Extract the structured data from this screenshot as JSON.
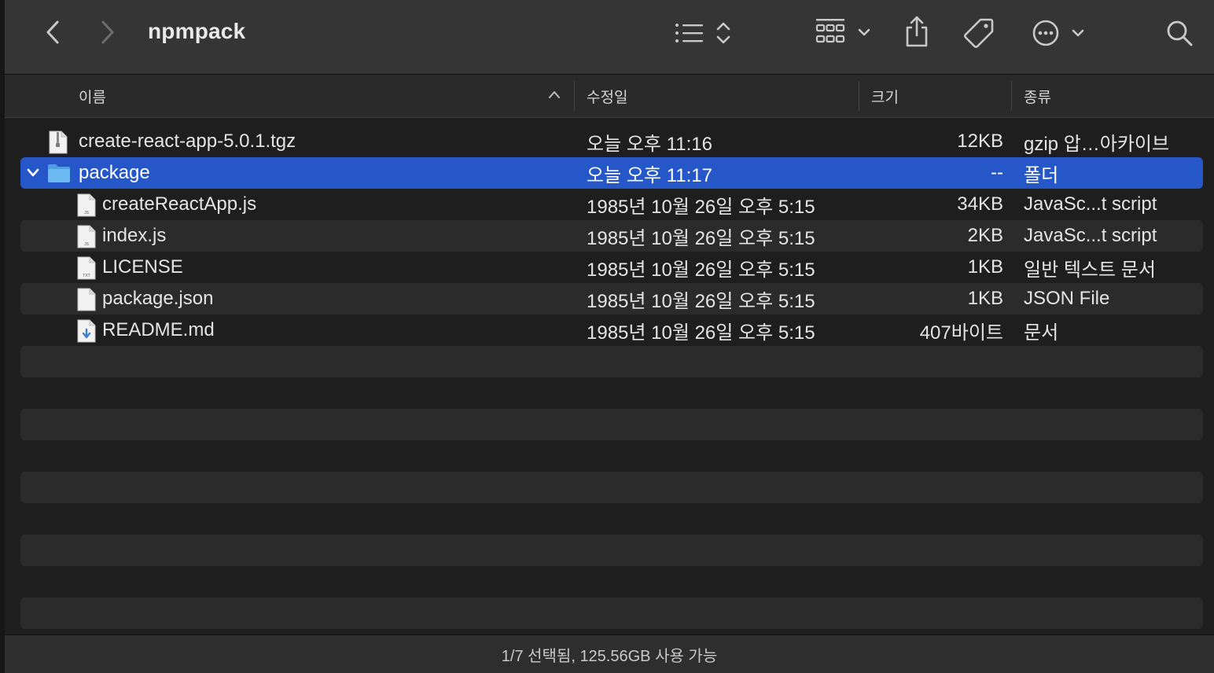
{
  "toolbar": {
    "title": "npmpack",
    "icons": [
      "back-icon",
      "forward-icon",
      "list-view-icon",
      "sort-updown-icon",
      "gallery-grid-icon",
      "chevron-down-icon",
      "share-icon",
      "tag-icon",
      "more-circle-icon",
      "chevron-down-icon",
      "search-icon"
    ]
  },
  "columns": {
    "name": "이름",
    "modified": "수정일",
    "size": "크기",
    "kind": "종류"
  },
  "files": [
    {
      "name": "create-react-app-5.0.1.tgz",
      "modified": "오늘 오후 11:16",
      "size": "12KB",
      "kind": "gzip 압…아카이브",
      "icon": "archive-file-icon"
    },
    {
      "name": "package",
      "modified": "오늘 오후 11:17",
      "size": "--",
      "kind": "폴더",
      "icon": "folder-icon",
      "selected": true,
      "expanded": true
    },
    {
      "name": "createReactApp.js",
      "modified": "1985년 10월 26일 오후 5:15",
      "size": "34KB",
      "kind": "JavaSc...t script",
      "icon": "js-file-icon"
    },
    {
      "name": "index.js",
      "modified": "1985년 10월 26일 오후 5:15",
      "size": "2KB",
      "kind": "JavaSc...t script",
      "icon": "js-file-icon"
    },
    {
      "name": "LICENSE",
      "modified": "1985년 10월 26일 오후 5:15",
      "size": "1KB",
      "kind": "일반 텍스트 문서",
      "icon": "txt-file-icon"
    },
    {
      "name": "package.json",
      "modified": "1985년 10월 26일 오후 5:15",
      "size": "1KB",
      "kind": "JSON File",
      "icon": "generic-file-icon"
    },
    {
      "name": "README.md",
      "modified": "1985년 10월 26일 오후 5:15",
      "size": "407바이트",
      "kind": "문서",
      "icon": "markdown-file-icon"
    }
  ],
  "status": {
    "text": "1/7 선택됨, 125.56GB 사용 가능"
  },
  "colors": {
    "selection": "#2557c8",
    "toolbar": "#353535",
    "background": "#1e1e1e",
    "folder": "#5aa9e6"
  }
}
